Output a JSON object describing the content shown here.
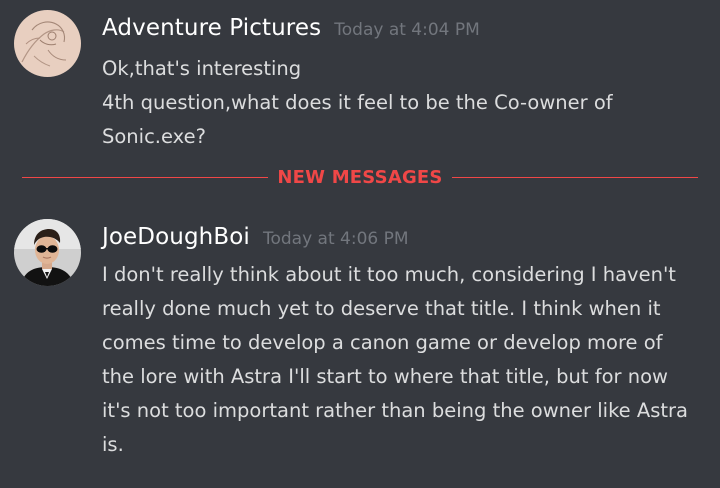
{
  "messages": [
    {
      "username": "Adventure Pictures",
      "timestamp": "Today at 4:04 PM",
      "avatar": "sketch-avatar",
      "lines": [
        "Ok,that's interesting",
        "4th question,what does it feel to be the Co-owner of",
        "Sonic.exe?"
      ]
    },
    {
      "username": "JoeDoughBoi",
      "timestamp": "Today at 4:06 PM",
      "avatar": "photo-avatar",
      "lines": [
        "I don't really think about it too much, considering I haven't",
        "really done much yet to deserve that title. I think when it",
        "comes time to develop a canon game or develop more of",
        "the lore with Astra I'll start to where that title, but for now",
        "it's not too important rather than being the owner like Astra",
        "is."
      ]
    }
  ],
  "divider": {
    "label": "NEW MESSAGES"
  },
  "colors": {
    "background": "#36393f",
    "username": "#ffffff",
    "timestamp": "#72767d",
    "text": "#dcddde",
    "new_messages": "#f04747"
  }
}
